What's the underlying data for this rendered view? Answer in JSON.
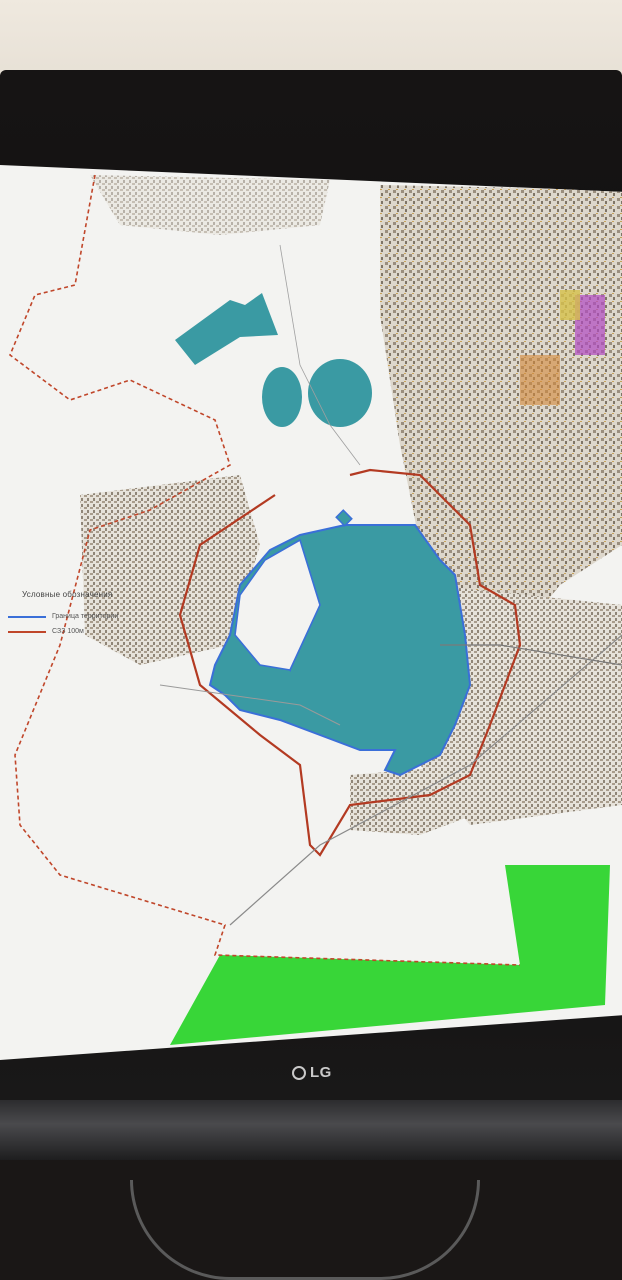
{
  "photo": {
    "device_brand": "LG"
  },
  "map": {
    "legend": {
      "title": "Условные обозначения",
      "items": [
        {
          "label": "Граница территории",
          "color": "#3a6fd8"
        },
        {
          "label": "СЗЗ 100м",
          "color": "#c0462a"
        }
      ]
    },
    "colors": {
      "water_fill": "#3a9aa3",
      "boundary": "#3a6fd8",
      "sanitary_zone": "#c0462a",
      "green_area": "#38d638",
      "urban_texture": "#b8ad9e"
    }
  }
}
